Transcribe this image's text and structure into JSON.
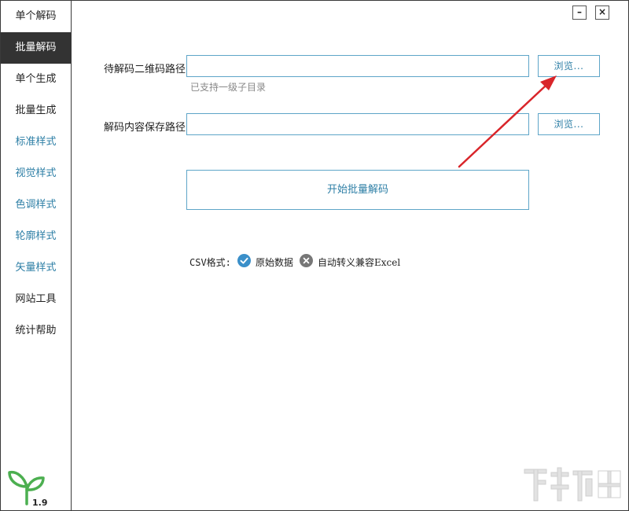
{
  "sidebar": {
    "items": [
      {
        "label": "单个解码"
      },
      {
        "label": "批量解码"
      },
      {
        "label": "单个生成"
      },
      {
        "label": "批量生成"
      },
      {
        "label": "标准样式"
      },
      {
        "label": "视觉样式"
      },
      {
        "label": "色调样式"
      },
      {
        "label": "轮廓样式"
      },
      {
        "label": "矢量样式"
      },
      {
        "label": "网站工具"
      },
      {
        "label": "统计帮助"
      }
    ],
    "active_index": 1,
    "version": "1.9"
  },
  "window_controls": {
    "minimize": "–",
    "close": "×"
  },
  "form": {
    "source_label": "待解码二维码路径",
    "source_value": "",
    "source_hint": "已支持一级子目录",
    "browse_label": "浏览...",
    "save_label": "解码内容保存路径",
    "save_value": "",
    "browse2_label": "浏览...",
    "start_label": "开始批量解码"
  },
  "csv": {
    "label": "CSV格式:",
    "option_raw": "原始数据",
    "option_excel": "自动转义兼容Excel",
    "raw_selected": true,
    "excel_selected": false
  },
  "colors": {
    "accent": "#2e7fa6",
    "border": "#5ea5c8",
    "active_nav_bg": "#333333",
    "check_blue": "#3a8fc9",
    "cross_gray": "#777777",
    "arrow_red": "#d9252a",
    "logo_green": "#4caf50"
  }
}
